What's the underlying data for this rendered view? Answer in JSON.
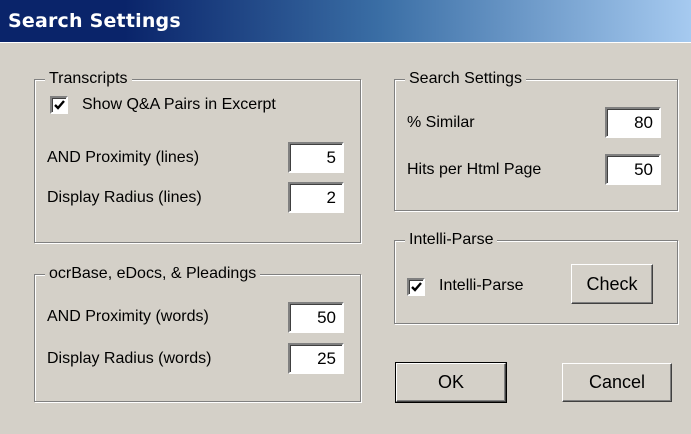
{
  "window": {
    "title": "Search Settings"
  },
  "transcripts": {
    "legend": "Transcripts",
    "show_qa_label": "Show Q&A Pairs in Excerpt",
    "show_qa_checked": true,
    "and_proximity_label": "AND Proximity (lines)",
    "and_proximity_value": "5",
    "display_radius_label": "Display Radius (lines)",
    "display_radius_value": "2"
  },
  "ocrbase": {
    "legend": "ocrBase, eDocs, & Pleadings",
    "and_proximity_label": "AND Proximity (words)",
    "and_proximity_value": "50",
    "display_radius_label": "Display Radius (words)",
    "display_radius_value": "25"
  },
  "search_settings": {
    "legend": "Search Settings",
    "similar_label": "% Similar",
    "similar_value": "80",
    "hits_label": "Hits per Html Page",
    "hits_value": "50"
  },
  "intelli_parse": {
    "legend": "Intelli-Parse",
    "checkbox_label": "Intelli-Parse",
    "checked": true,
    "check_button": "Check"
  },
  "buttons": {
    "ok": "OK",
    "cancel": "Cancel"
  }
}
